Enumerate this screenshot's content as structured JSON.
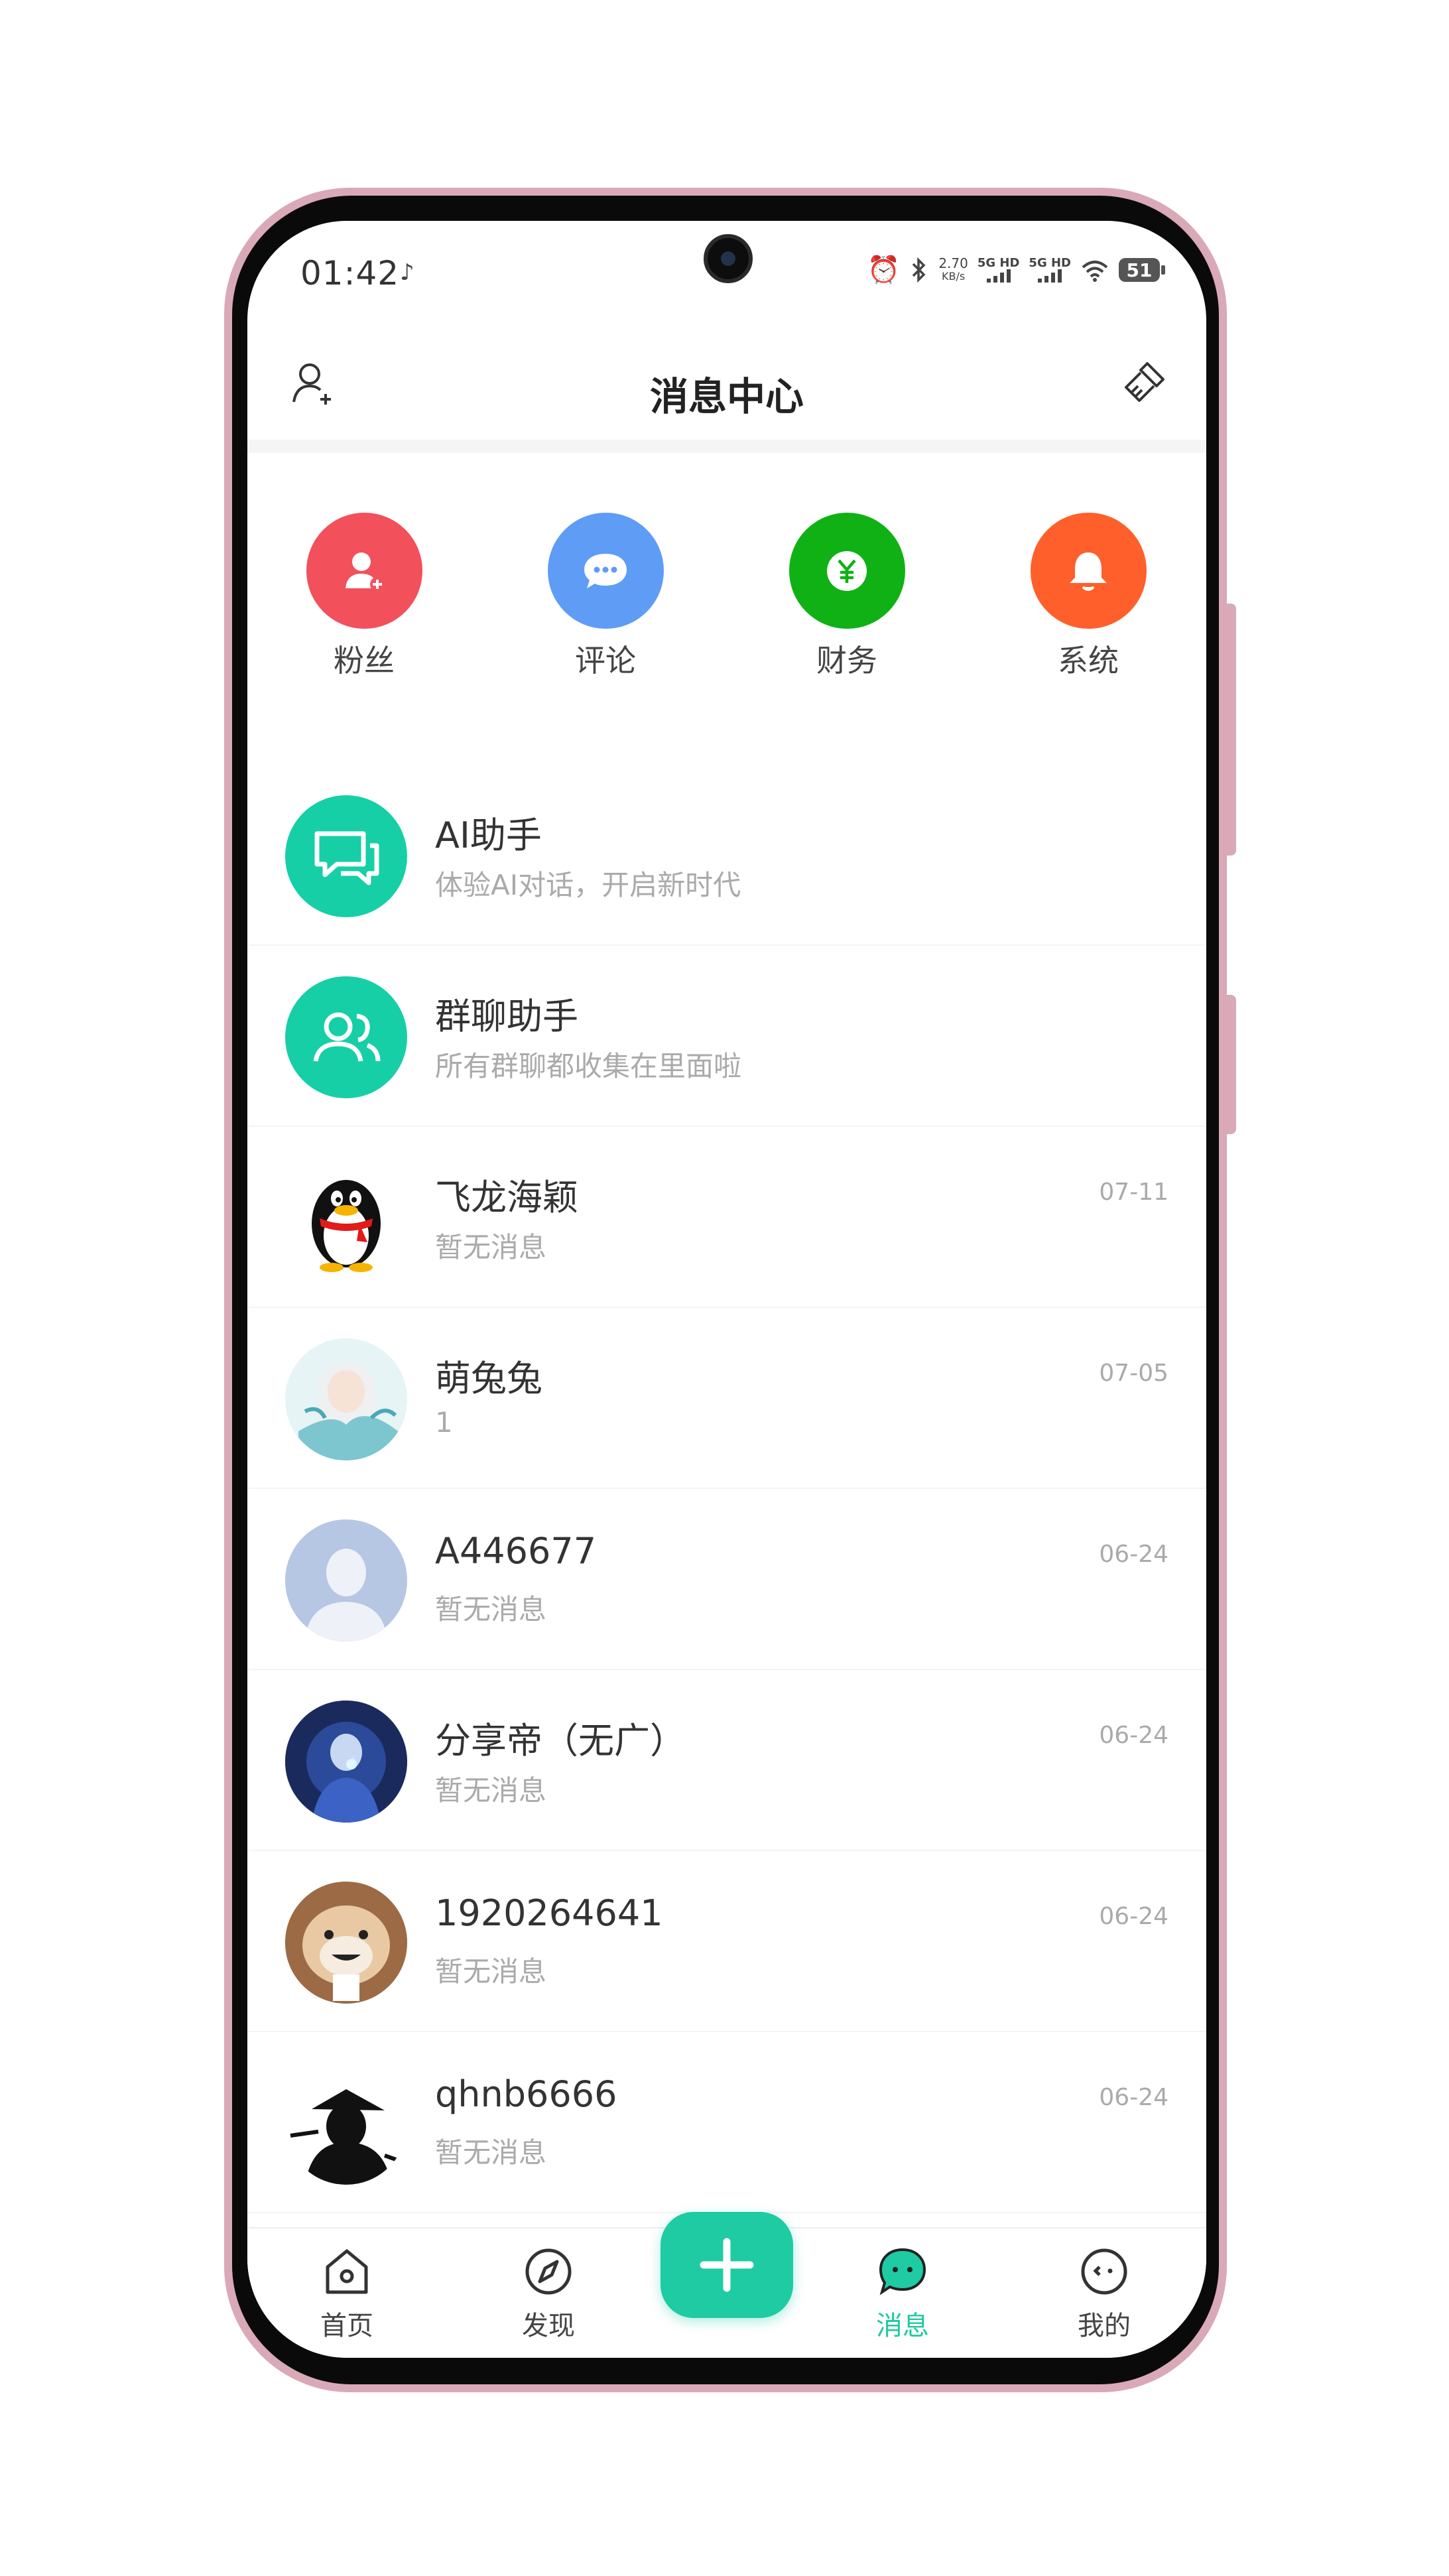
{
  "status_bar": {
    "time": "01:42",
    "net_speed": "2.70",
    "net_speed_unit": "KB/s",
    "network_1": "5G HD",
    "network_2": "5G HD",
    "battery": "51"
  },
  "header": {
    "title": "消息中心",
    "left_icon": "add-user-icon",
    "right_icon": "clear-brush-icon"
  },
  "quick_entries": [
    {
      "label": "粉丝",
      "color": "#f2505a",
      "icon": "fan-icon"
    },
    {
      "label": "评论",
      "color": "#5e9cf6",
      "icon": "comment-icon"
    },
    {
      "label": "财务",
      "color": "#10b114",
      "icon": "yuan-icon"
    },
    {
      "label": "系统",
      "color": "#ff5f2a",
      "icon": "bell-icon"
    }
  ],
  "messages": [
    {
      "name": "AI助手",
      "preview": "体验AI对话，开启新时代",
      "time": ""
    },
    {
      "name": "群聊助手",
      "preview": "所有群聊都收集在里面啦",
      "time": ""
    },
    {
      "name": "飞龙海颖",
      "preview": "暂无消息",
      "time": "07-11"
    },
    {
      "name": "萌兔兔",
      "preview": "1",
      "time": "07-05"
    },
    {
      "name": "A446677",
      "preview": "暂无消息",
      "time": "06-24"
    },
    {
      "name": "分享帝（无广）",
      "preview": "暂无消息",
      "time": "06-24"
    },
    {
      "name": "1920264641",
      "preview": "暂无消息",
      "time": "06-24"
    },
    {
      "name": "qhnb6666",
      "preview": "暂无消息",
      "time": "06-24"
    }
  ],
  "tab_bar": {
    "tabs": [
      {
        "label": "首页",
        "icon": "home-icon"
      },
      {
        "label": "发现",
        "icon": "compass-icon"
      },
      {
        "label": "消息",
        "icon": "message-icon",
        "active": true
      },
      {
        "label": "我的",
        "icon": "profile-icon"
      }
    ],
    "accent_color": "#1ecba3"
  }
}
